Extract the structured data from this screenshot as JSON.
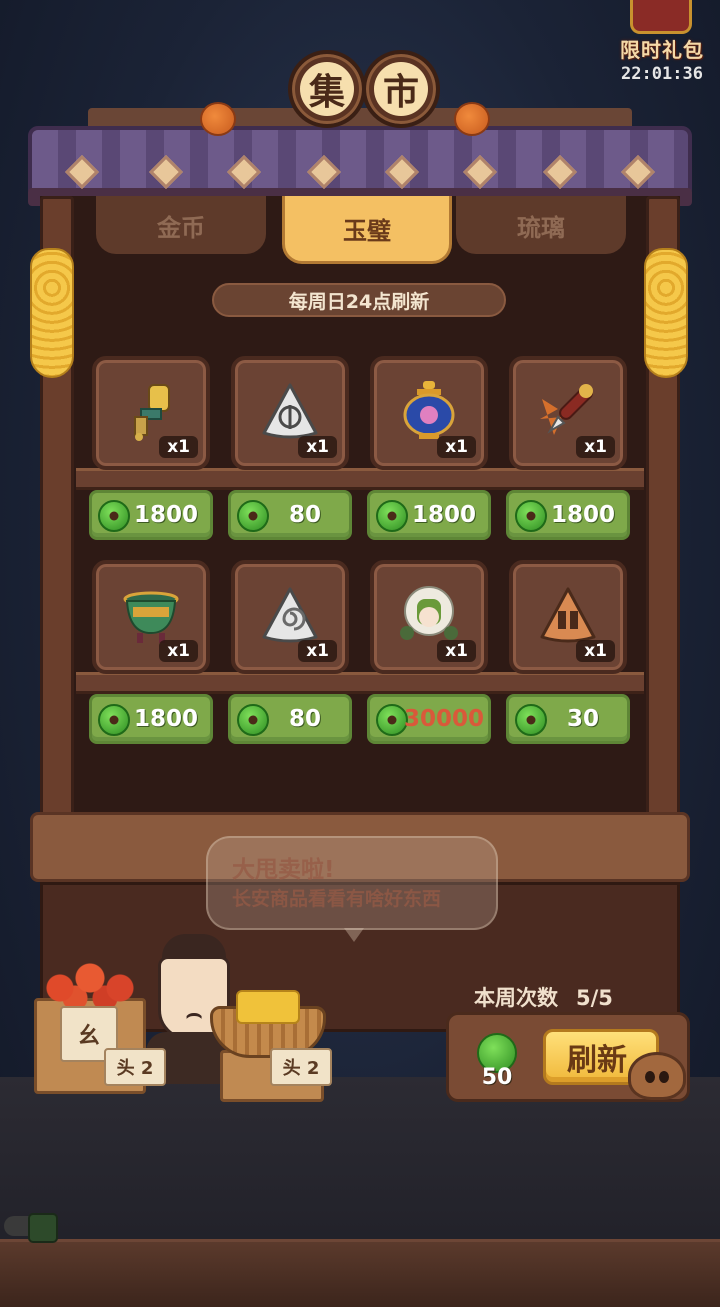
{
  "promo": {
    "label": "限时礼包",
    "timer": "22:01:36"
  },
  "shop_sign": {
    "char1": "集",
    "char2": "市"
  },
  "tabs": [
    {
      "label": "金币",
      "active": false
    },
    {
      "label": "玉璧",
      "active": true
    },
    {
      "label": "琉璃",
      "active": false
    }
  ],
  "refresh_note": "每周日24点刷新",
  "items": [
    {
      "icon": "glove-icon",
      "qty": "x1",
      "price": "1800"
    },
    {
      "icon": "rune-stone-icon",
      "qty": "x1",
      "price": "80"
    },
    {
      "icon": "cloisonne-jar-icon",
      "qty": "x1",
      "price": "1800"
    },
    {
      "icon": "brush-icon",
      "qty": "x1",
      "price": "1800"
    },
    {
      "icon": "bronze-cauldron-icon",
      "qty": "x1",
      "price": "1800"
    },
    {
      "icon": "spiral-rune-stone-icon",
      "qty": "x1",
      "price": "80"
    },
    {
      "icon": "character-portrait-icon",
      "qty": "x1",
      "price": "30000",
      "unaffordable": true
    },
    {
      "icon": "copper-rune-stone-icon",
      "qty": "x1",
      "price": "30"
    }
  ],
  "bubble": {
    "line1": "大甩卖啦!",
    "line2": "长安商品看看有啥好东西"
  },
  "vendor_tags": [
    "头 2",
    "头 2"
  ],
  "weekly": {
    "label": "本周次数",
    "count": "5/5"
  },
  "refresh": {
    "cost": "50",
    "button": "刷新"
  }
}
